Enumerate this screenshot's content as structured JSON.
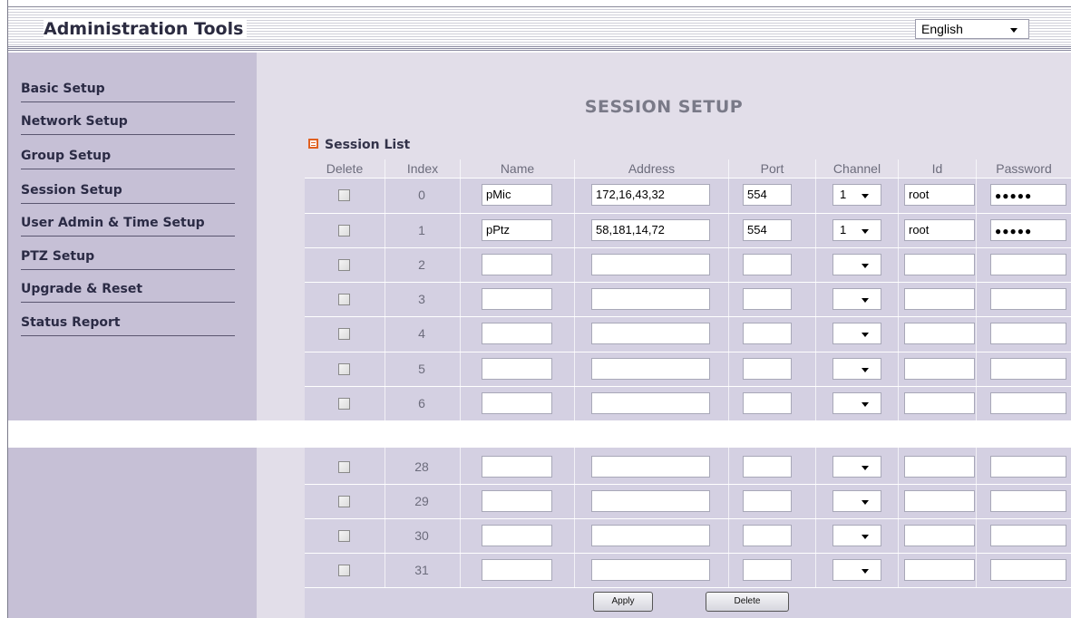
{
  "header": {
    "title": "Administration Tools",
    "language": "English"
  },
  "sidebar": {
    "items": [
      {
        "label": "Basic Setup"
      },
      {
        "label": "Network Setup"
      },
      {
        "label": "Group Setup"
      },
      {
        "label": "Session Setup"
      },
      {
        "label": "User Admin & Time Setup"
      },
      {
        "label": "PTZ Setup"
      },
      {
        "label": "Upgrade & Reset"
      },
      {
        "label": "Status Report"
      }
    ]
  },
  "page": {
    "title": "SESSION SETUP",
    "section_title": "Session List"
  },
  "table": {
    "columns": [
      "Delete",
      "Index",
      "Name",
      "Address",
      "Port",
      "Channel",
      "Id",
      "Password"
    ],
    "rows": [
      {
        "index": "0",
        "name": "pMic",
        "address": "172,16,43,32",
        "port": "554",
        "channel": "1",
        "id": "root",
        "password": "●●●●●"
      },
      {
        "index": "1",
        "name": "pPtz",
        "address": "58,181,14,72",
        "port": "554",
        "channel": "1",
        "id": "root",
        "password": "●●●●●"
      },
      {
        "index": "2",
        "name": "",
        "address": "",
        "port": "",
        "channel": "",
        "id": "",
        "password": ""
      },
      {
        "index": "3",
        "name": "",
        "address": "",
        "port": "",
        "channel": "",
        "id": "",
        "password": ""
      },
      {
        "index": "4",
        "name": "",
        "address": "",
        "port": "",
        "channel": "",
        "id": "",
        "password": ""
      },
      {
        "index": "5",
        "name": "",
        "address": "",
        "port": "",
        "channel": "",
        "id": "",
        "password": ""
      },
      {
        "index": "6",
        "name": "",
        "address": "",
        "port": "",
        "channel": "",
        "id": "",
        "password": ""
      },
      {
        "index": "28",
        "name": "",
        "address": "",
        "port": "",
        "channel": "",
        "id": "",
        "password": ""
      },
      {
        "index": "29",
        "name": "",
        "address": "",
        "port": "",
        "channel": "",
        "id": "",
        "password": ""
      },
      {
        "index": "30",
        "name": "",
        "address": "",
        "port": "",
        "channel": "",
        "id": "",
        "password": ""
      },
      {
        "index": "31",
        "name": "",
        "address": "",
        "port": "",
        "channel": "",
        "id": "",
        "password": ""
      }
    ]
  },
  "buttons": {
    "apply": "Apply",
    "delete": "Delete"
  }
}
